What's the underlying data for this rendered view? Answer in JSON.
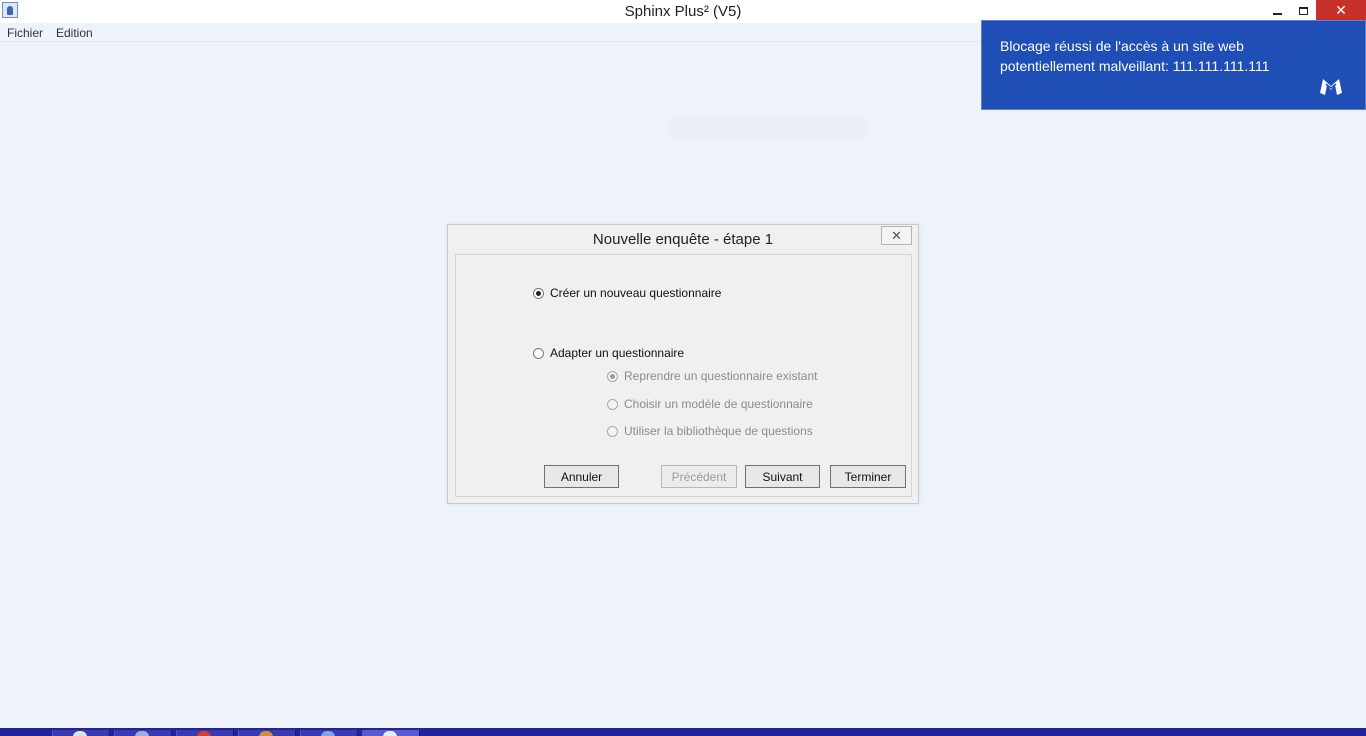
{
  "window": {
    "title": "Sphinx Plus² (V5)",
    "close_glyph": "✕"
  },
  "menu": {
    "fichier": "Fichier",
    "edition": "Edition"
  },
  "notification": {
    "text": "Blocage réussi de l'accès à un site web potentiellement malveillant: 111.111.111.111",
    "logo_icon": "malwarebytes-logo-icon",
    "background": "#1e4eb6"
  },
  "dialog": {
    "title": "Nouvelle enquête - étape 1",
    "close_glyph": "✕",
    "options": {
      "create_new": {
        "label": "Créer un nouveau questionnaire",
        "checked": true
      },
      "adapt": {
        "label": "Adapter un questionnaire",
        "checked": false
      },
      "reuse_existing": {
        "label": "Reprendre un questionnaire existant",
        "checked": true,
        "disabled": true
      },
      "choose_model": {
        "label": "Choisir un modèle de questionnaire",
        "checked": false,
        "disabled": true
      },
      "use_library": {
        "label": "Utiliser la bibliothèque de questions",
        "checked": false,
        "disabled": true
      }
    },
    "buttons": {
      "cancel": "Annuler",
      "previous": "Précédent",
      "next": "Suivant",
      "finish": "Terminer"
    }
  }
}
